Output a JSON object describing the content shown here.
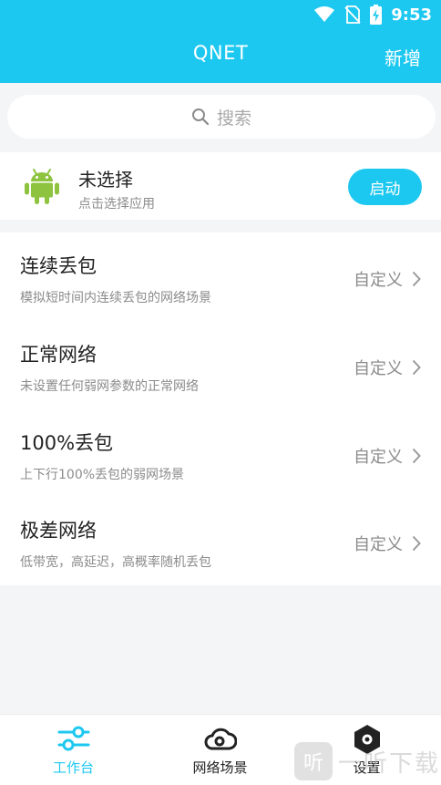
{
  "status_bar": {
    "time": "9:53",
    "icons": [
      "wifi-icon",
      "no-sim-icon",
      "battery-charging-icon"
    ]
  },
  "header": {
    "title": "QNET",
    "add_label": "新增"
  },
  "search": {
    "placeholder": "搜索",
    "icon": "search-icon"
  },
  "app": {
    "name": "未选择",
    "subtitle": "点击选择应用",
    "start_label": "启动",
    "icon": "android-icon"
  },
  "scenes": [
    {
      "title": "连续丢包",
      "desc": "模拟短时间内连续丢包的网络场景",
      "action": "自定义"
    },
    {
      "title": "正常网络",
      "desc": "未设置任何弱网参数的正常网络",
      "action": "自定义"
    },
    {
      "title": "100%丢包",
      "desc": "上下行100%丢包的弱网场景",
      "action": "自定义"
    },
    {
      "title": "极差网络",
      "desc": "低带宽，高延迟，高概率随机丢包",
      "action": "自定义"
    }
  ],
  "tabs": [
    {
      "label": "工作台",
      "icon": "sliders-icon",
      "active": true
    },
    {
      "label": "网络场景",
      "icon": "cloud-icon",
      "active": false
    },
    {
      "label": "设置",
      "icon": "hexagon-gear-icon",
      "active": false
    }
  ],
  "watermark": {
    "badge": "听",
    "text": "一听下载"
  },
  "colors": {
    "accent": "#1DC8F0",
    "android_green": "#8DC33F",
    "background": "#F4F5F7",
    "text_primary": "#222222",
    "text_secondary": "#8B8B8B"
  }
}
